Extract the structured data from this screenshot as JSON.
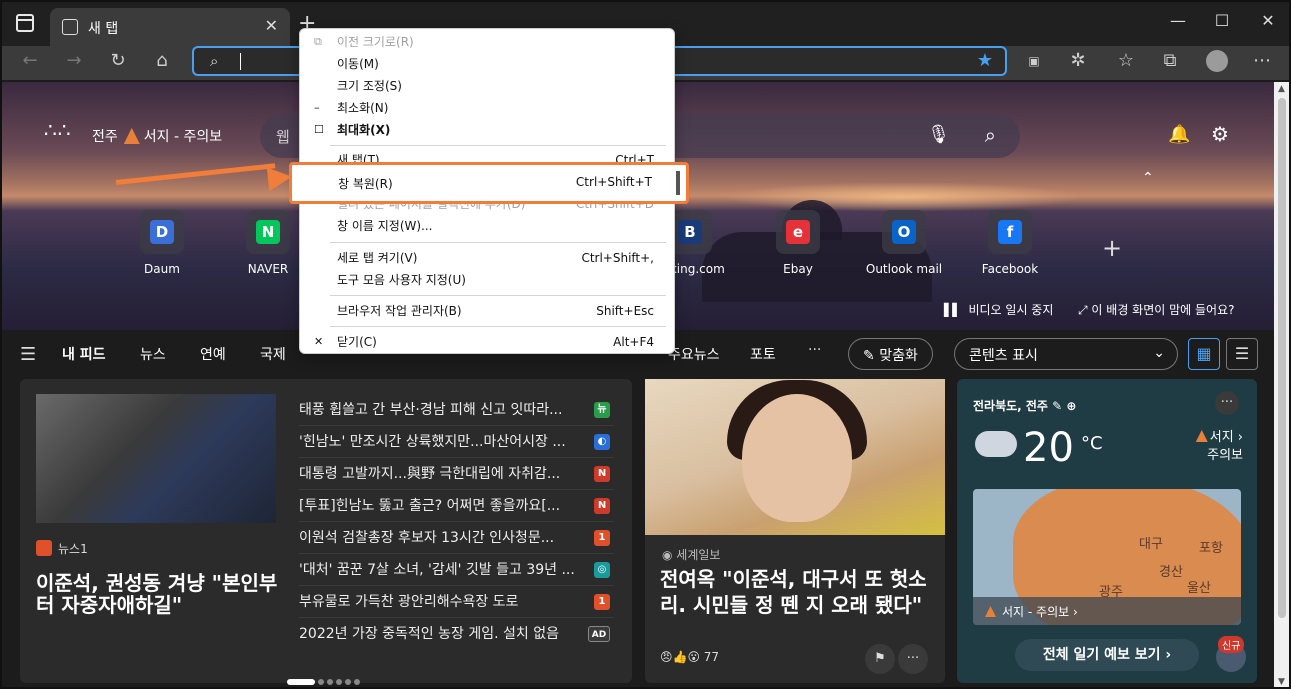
{
  "browser": {
    "tab_title": "새 탭",
    "tab_close": "✕",
    "new_tab": "+",
    "window_controls": [
      "—",
      "☐",
      "✕"
    ],
    "address_placeholder": "",
    "icons": [
      "back-icon",
      "forward-icon",
      "refresh-icon",
      "home-icon",
      "search-icon",
      "favorite-star-icon",
      "extension-icon",
      "favorites-icon",
      "collections-icon",
      "profile-icon",
      "more-icon"
    ]
  },
  "hero": {
    "location": "전주",
    "alert": "서지 - 주의보",
    "search_placeholder": "웹",
    "pause_label": "비디오 일시 중지",
    "whatbg_label": "이 배경 화면이 맘에 들어요?",
    "quick_links": [
      {
        "label": "Daum",
        "letter": "D",
        "color": "#3b6fd8"
      },
      {
        "label": "NAVER",
        "letter": "N",
        "color": "#03c75a"
      },
      {
        "label": "ooking.com",
        "letter": "B",
        "color": "#1a3b7a"
      },
      {
        "label": "Ebay",
        "letter": "e",
        "color": "#e53238"
      },
      {
        "label": "Outlook mail",
        "letter": "O",
        "color": "#0a64c8"
      },
      {
        "label": "Facebook",
        "letter": "f",
        "color": "#1877f2"
      }
    ]
  },
  "feed_nav": {
    "items": [
      "내 피드",
      "뉴스",
      "연예",
      "국제"
    ],
    "partial": "주요뉴스",
    "photo": "포토",
    "more": "···",
    "customize": "맞춤화",
    "content_view": "콘텐츠 표시"
  },
  "card1": {
    "source": "뉴스1",
    "headline": "이준석, 권성동 겨냥 \"본인부터 자중자애하길\"",
    "list": [
      {
        "text": "태풍 휩쓸고 간 부산·경남 피해 신고 잇따라...",
        "icon_color": "#2a9d4a",
        "icon": "뉴"
      },
      {
        "text": "'힌남노' 만조시간 상륙했지만...마산어시장 ...",
        "icon_color": "#2a6fd8",
        "icon": "◐"
      },
      {
        "text": "대통령 고발까지...與野 극한대립에 자취감...",
        "icon_color": "#d03a2b",
        "icon": "N"
      },
      {
        "text": "[투표]힌남노 뚫고 출근? 어쩌면 좋을까요[...",
        "icon_color": "#d03a2b",
        "icon": "N"
      },
      {
        "text": "이원석 검찰총장 후보자 13시간 인사청문...",
        "icon_color": "#e0502b",
        "icon": "1"
      },
      {
        "text": "'대처' 꿈꾼 7살 소녀, '감세' 깃발 들고 39년 ...",
        "icon_color": "#1a9a9a",
        "icon": "◎"
      },
      {
        "text": "부유물로 가득찬 광안리해수욕장 도로",
        "icon_color": "#e0502b",
        "icon": "1"
      },
      {
        "text": "2022년 가장 중독적인 농장 게임. 설치 없음",
        "icon_color": "#3a3a3a",
        "icon": "AD"
      }
    ]
  },
  "card2": {
    "source": "세계일보",
    "headline": "전여옥 \"이준석, 대구서 또 헛소리. 시민들 정 뗀 지 오래 됐다\"",
    "reactions": "77"
  },
  "weather": {
    "location": "전라북도, 전주",
    "temp": "20",
    "unit": "°C",
    "alert_line1": "서지",
    "alert_line2": "주의보",
    "map_labels": [
      "대구",
      "포항",
      "경산",
      "울산",
      "광주"
    ],
    "map_bar": "서지 - 주의보 ›",
    "forecast_btn": "전체 일기 예보 보기 ›",
    "new_badge": "신규"
  },
  "context_menu": {
    "items": [
      {
        "label": "이전 크기로(R)",
        "shortcut": "",
        "disabled": true,
        "mark": "⧉"
      },
      {
        "label": "이동(M)",
        "shortcut": "",
        "disabled": false,
        "mark": ""
      },
      {
        "label": "크기 조정(S)",
        "shortcut": "",
        "disabled": false,
        "mark": ""
      },
      {
        "label": "최소화(N)",
        "shortcut": "",
        "disabled": false,
        "mark": "–"
      },
      {
        "label": "최대화(X)",
        "shortcut": "",
        "disabled": false,
        "mark": "☐"
      },
      {
        "label": "새 탭(T)",
        "shortcut": "Ctrl+T",
        "disabled": false,
        "mark": ""
      },
      {
        "label": "창 복원(R)",
        "shortcut": "Ctrl+Shift+T",
        "disabled": false,
        "mark": ""
      },
      {
        "label": "열려 있는 페이지를 컬렉션에 추가(D)",
        "shortcut": "Ctrl+Shift+D",
        "disabled": true,
        "mark": ""
      },
      {
        "label": "창 이름 지정(W)...",
        "shortcut": "",
        "disabled": false,
        "mark": ""
      },
      {
        "label": "세로 탭 켜기(V)",
        "shortcut": "Ctrl+Shift+,",
        "disabled": false,
        "mark": ""
      },
      {
        "label": "도구 모음 사용자 지정(U)",
        "shortcut": "",
        "disabled": false,
        "mark": ""
      },
      {
        "label": "브라우저 작업 관리자(B)",
        "shortcut": "Shift+Esc",
        "disabled": false,
        "mark": ""
      },
      {
        "label": "닫기(C)",
        "shortcut": "Alt+F4",
        "disabled": false,
        "mark": "✕"
      }
    ]
  }
}
